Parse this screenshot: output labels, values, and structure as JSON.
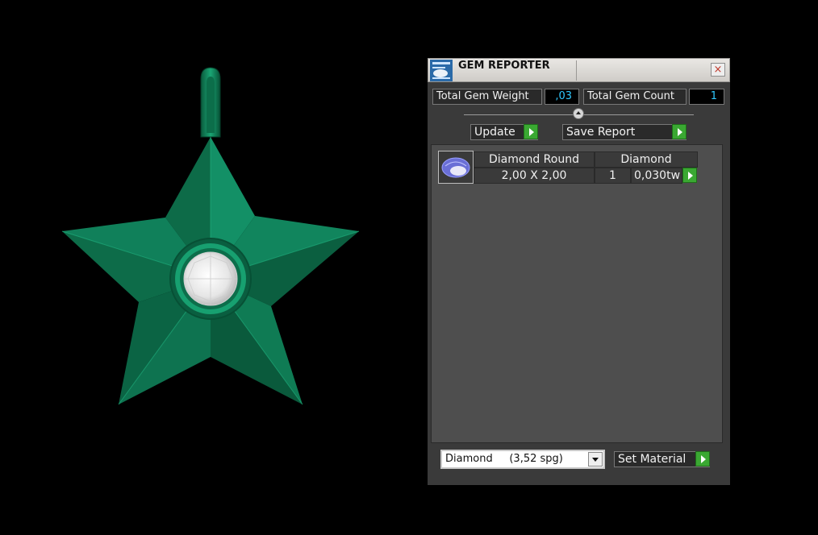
{
  "window": {
    "title": "GEM REPORTER",
    "close_label": "×"
  },
  "stats": {
    "weight_label": "Total Gem Weight",
    "weight_value": ",03",
    "count_label": "Total Gem Count",
    "count_value": "1"
  },
  "actions": {
    "update_label": "Update",
    "save_label": "Save Report"
  },
  "gem_row": {
    "icon": "round-gem-icon",
    "name": "Diamond Round",
    "size": "2,00 X 2,00",
    "material": "Diamond",
    "count": "1",
    "weight": "0,030tw"
  },
  "material": {
    "selected": "Diamond     (3,52 spg)",
    "set_label": "Set Material"
  },
  "colors": {
    "star": "#0e7a52",
    "accent_green": "#3aa832",
    "value_cyan": "#2fc9ff"
  }
}
